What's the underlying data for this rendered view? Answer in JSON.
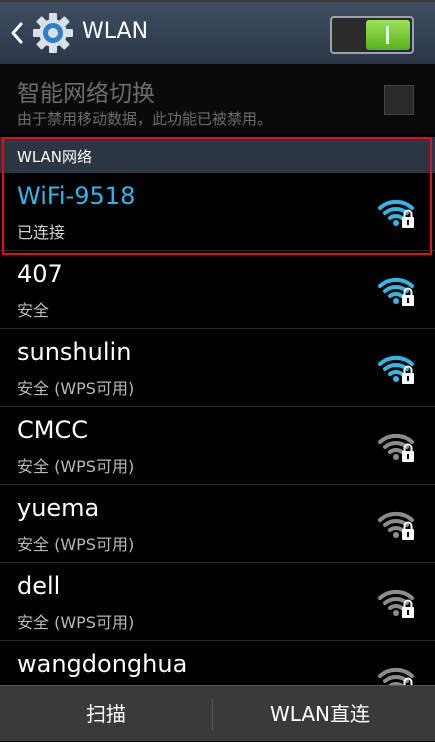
{
  "header": {
    "title": "WLAN",
    "toggle_on": true
  },
  "smart_switch": {
    "title": "智能网络切换",
    "subtitle": "由于禁用移动数据，此功能已被禁用。",
    "checked": false
  },
  "section": {
    "label": "WLAN网络"
  },
  "networks": [
    {
      "name": "WiFi-9518",
      "status": "已连接",
      "signal_color": "#33b5e5",
      "connected": true
    },
    {
      "name": "407",
      "status": "安全",
      "signal_color": "#33b5e5",
      "connected": false
    },
    {
      "name": "sunshulin",
      "status": "安全 (WPS可用)",
      "signal_color": "#33b5e5",
      "connected": false
    },
    {
      "name": "CMCC",
      "status": "安全 (WPS可用)",
      "signal_color": "#8c8c8c",
      "connected": false
    },
    {
      "name": "yuema",
      "status": "安全 (WPS可用)",
      "signal_color": "#8c8c8c",
      "connected": false
    },
    {
      "name": "dell",
      "status": "安全 (WPS可用)",
      "signal_color": "#8c8c8c",
      "connected": false
    },
    {
      "name": "wangdonghua",
      "status": "",
      "signal_color": "#8c8c8c",
      "connected": false
    }
  ],
  "bottom": {
    "scan_label": "扫描",
    "direct_label": "WLAN直连"
  },
  "colors": {
    "accent": "#33b5e5",
    "highlight": "#e11010"
  }
}
